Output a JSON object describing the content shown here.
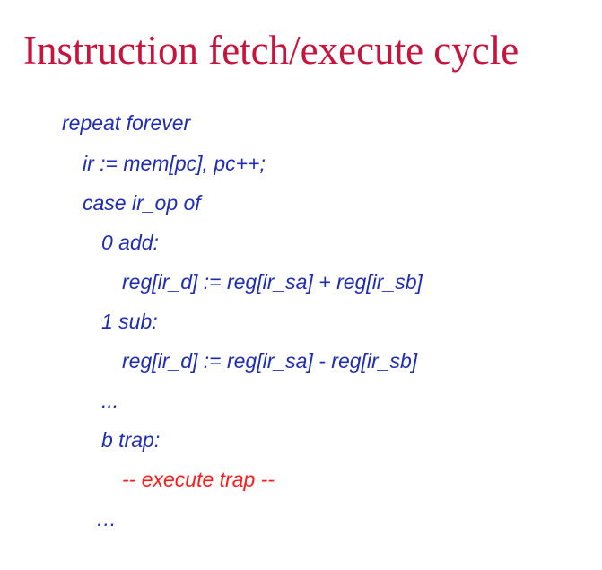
{
  "slide": {
    "title": "Instruction fetch/execute cycle",
    "colors": {
      "title": "#c8143c",
      "code": "#1f2db4",
      "trap": "#ff1a1a",
      "background": "#ffffff"
    },
    "code_lines": [
      "repeat forever",
      "ir := mem[pc], pc++;",
      "case ir_op of",
      "0 add:",
      "reg[ir_d] := reg[ir_sa] + reg[ir_sb]",
      "1 sub:",
      "reg[ir_d] := reg[ir_sa] - reg[ir_sb]",
      "...",
      "b trap:",
      "-- execute trap --",
      "…"
    ]
  }
}
